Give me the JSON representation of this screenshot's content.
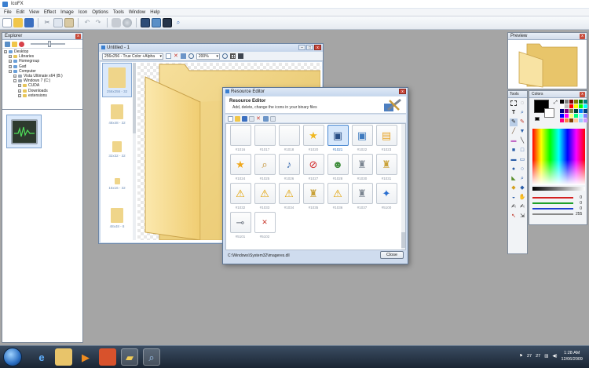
{
  "app": {
    "title": "IcoFX"
  },
  "menu": [
    "File",
    "Edit",
    "View",
    "Effect",
    "Image",
    "Icon",
    "Options",
    "Tools",
    "Window",
    "Help"
  ],
  "explorer": {
    "title": "Explorer",
    "tree": [
      {
        "label": "Desktop",
        "indent": 0,
        "icon": "desktop"
      },
      {
        "label": "Libraries",
        "indent": 1,
        "icon": "folder"
      },
      {
        "label": "Homegroup",
        "indent": 1,
        "icon": "homegroup"
      },
      {
        "label": "Gad",
        "indent": 1,
        "icon": "user"
      },
      {
        "label": "Computer",
        "indent": 1,
        "icon": "computer"
      },
      {
        "label": "Vista Ultimate x64 (B:)",
        "indent": 2,
        "icon": "drive"
      },
      {
        "label": "Windows 7 (C:)",
        "indent": 2,
        "icon": "drive"
      },
      {
        "label": "CUDA",
        "indent": 3,
        "icon": "folder"
      },
      {
        "label": "Downloads",
        "indent": 3,
        "icon": "folder"
      },
      {
        "label": "extensions",
        "indent": 3,
        "icon": "folder"
      }
    ]
  },
  "document": {
    "title": "Untitled - 1",
    "format": "256x256 - True Color +Alpha",
    "zoom": "200%",
    "strip": [
      {
        "caption": "256x256 - 32",
        "selected": true,
        "size": 22
      },
      {
        "caption": "48x48 - 32",
        "selected": false,
        "size": 16
      },
      {
        "caption": "32x32 - 32",
        "selected": false,
        "size": 12
      },
      {
        "caption": "16x16 - 32",
        "selected": false,
        "size": 7
      },
      {
        "caption": "48x48 - 8",
        "selected": false,
        "size": 16
      }
    ]
  },
  "resource_editor": {
    "title": "Resource Editor",
    "heading": "Resource Editor",
    "subheading": "Add, delete, change the icons in your binary files",
    "path": "C:\\Windows\\System32\\imageres.dll",
    "close_label": "Close",
    "icons": [
      {
        "label": "#1016",
        "icon": "blank",
        "selected": false
      },
      {
        "label": "#1017",
        "icon": "blank",
        "selected": false
      },
      {
        "label": "#1018",
        "icon": "blank",
        "selected": false
      },
      {
        "label": "#1020",
        "icon": "star-doc",
        "selected": false
      },
      {
        "label": "#1021",
        "icon": "monitor",
        "selected": true
      },
      {
        "label": "#1022",
        "icon": "network-monitor",
        "selected": false
      },
      {
        "label": "#1023",
        "icon": "window",
        "selected": false
      },
      {
        "label": "#1024",
        "icon": "star",
        "selected": false
      },
      {
        "label": "#1025",
        "icon": "search-doc",
        "selected": false
      },
      {
        "label": "#1026",
        "icon": "music-doc",
        "selected": false
      },
      {
        "label": "#1027",
        "icon": "blocked",
        "selected": false
      },
      {
        "label": "#1028",
        "icon": "user-green",
        "selected": false
      },
      {
        "label": "#1030",
        "icon": "network-share",
        "selected": false
      },
      {
        "label": "#1031",
        "icon": "lock-network",
        "selected": false
      },
      {
        "label": "#1032",
        "icon": "warn-network",
        "selected": false
      },
      {
        "label": "#1033",
        "icon": "warn-network",
        "selected": false
      },
      {
        "label": "#1034",
        "icon": "warn-network",
        "selected": false
      },
      {
        "label": "#1035",
        "icon": "lock-network",
        "selected": false
      },
      {
        "label": "#1036",
        "icon": "warn-network",
        "selected": false
      },
      {
        "label": "#1037",
        "icon": "network-share",
        "selected": false
      },
      {
        "label": "#5100",
        "icon": "pin-blue",
        "selected": false
      },
      {
        "label": "#5101",
        "icon": "pin-gray",
        "selected": false
      },
      {
        "label": "#5102",
        "icon": "red-box",
        "selected": false
      }
    ]
  },
  "preview": {
    "title": "Preview"
  },
  "tools": {
    "title": "Tools"
  },
  "colors": {
    "title": "Colors",
    "sliders": [
      {
        "color": "#d42020",
        "value": "0"
      },
      {
        "color": "#1fa02a",
        "value": "0"
      },
      {
        "color": "#2040d0",
        "value": "0"
      },
      {
        "color": "#888888",
        "value": "255"
      }
    ]
  },
  "taskbar": {
    "time": "1:28 AM",
    "date": "12/06/2009",
    "tray_a": "27",
    "tray_b": "27"
  }
}
